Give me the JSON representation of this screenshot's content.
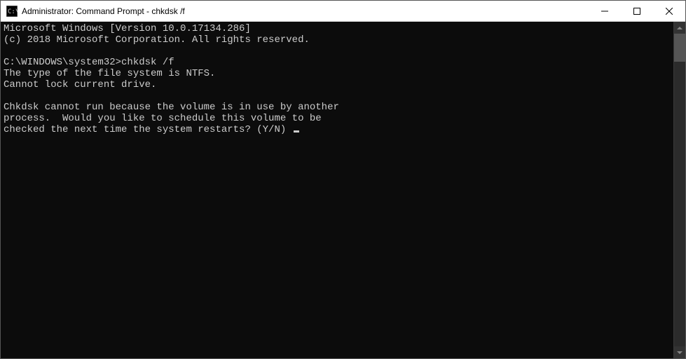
{
  "titlebar": {
    "title": "Administrator: Command Prompt - chkdsk  /f"
  },
  "terminal": {
    "lines": [
      "Microsoft Windows [Version 10.0.17134.286]",
      "(c) 2018 Microsoft Corporation. All rights reserved.",
      "",
      "C:\\WINDOWS\\system32>chkdsk /f",
      "The type of the file system is NTFS.",
      "Cannot lock current drive.",
      "",
      "Chkdsk cannot run because the volume is in use by another",
      "process.  Would you like to schedule this volume to be",
      "checked the next time the system restarts? (Y/N) "
    ]
  }
}
